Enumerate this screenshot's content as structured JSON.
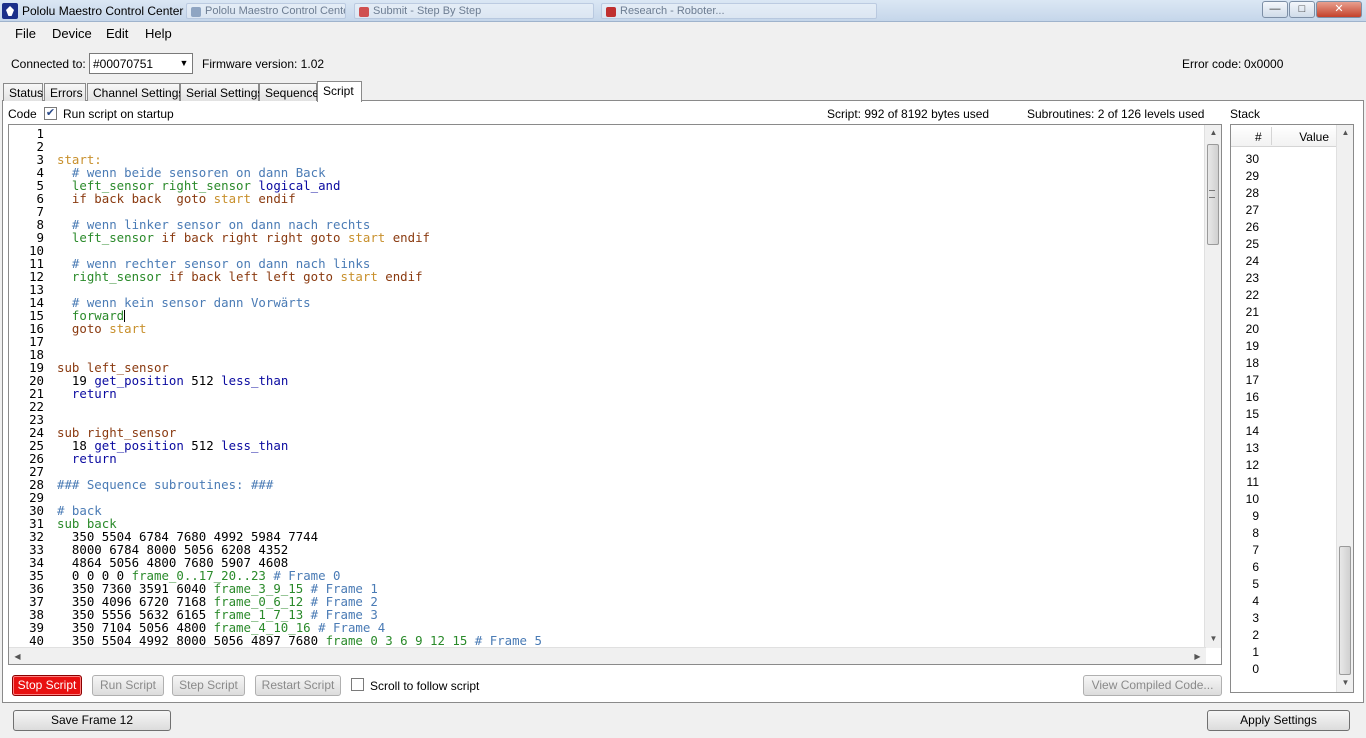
{
  "window": {
    "title": "Pololu Maestro Control Center",
    "background_tabs": [
      "Pololu Maestro Control Center (Windows) - ...",
      "Submit - Step By Step",
      "Research - Roboter..."
    ],
    "controls": {
      "minimize": "—",
      "maximize": "□",
      "close": "✕"
    }
  },
  "menu": [
    "File",
    "Device",
    "Edit",
    "Help"
  ],
  "connection": {
    "label": "Connected to:",
    "device": "#00070751",
    "firmware": "Firmware version: 1.02",
    "error_label": "Error code:",
    "error_value": "0x0000"
  },
  "tabs": [
    "Status",
    "Errors",
    "Channel Settings",
    "Serial Settings",
    "Sequence",
    "Script"
  ],
  "active_tab": "Script",
  "script": {
    "code_label": "Code",
    "run_on_startup_label": "Run script on startup",
    "run_on_startup": true,
    "bytes_used": "Script: 992 of 8192 bytes used",
    "subroutines": "Subroutines: 2 of 126 levels used",
    "cursor_line": 15
  },
  "code_lines": [
    {
      "n": "1",
      "parts": []
    },
    {
      "n": "2",
      "parts": []
    },
    {
      "n": "3",
      "parts": [
        {
          "t": "start:",
          "c": "#c8902c"
        }
      ]
    },
    {
      "n": "4",
      "parts": [
        {
          "t": "  # wenn beide sensoren on dann Back",
          "c": "#4a7bb5"
        }
      ]
    },
    {
      "n": "5",
      "parts": [
        {
          "t": "  left_sensor right_sensor ",
          "c": "#2a8a2a"
        },
        {
          "t": "logical_and",
          "c": "#0a0aa0"
        }
      ]
    },
    {
      "n": "6",
      "parts": [
        {
          "t": "  if back back  goto ",
          "c": "#8a3a10"
        },
        {
          "t": "start",
          "c": "#c8902c"
        },
        {
          "t": " endif",
          "c": "#8a3a10"
        }
      ]
    },
    {
      "n": "7",
      "parts": []
    },
    {
      "n": "8",
      "parts": [
        {
          "t": "  # wenn linker sensor on dann nach rechts",
          "c": "#4a7bb5"
        }
      ]
    },
    {
      "n": "9",
      "parts": [
        {
          "t": "  left_sensor ",
          "c": "#2a8a2a"
        },
        {
          "t": "if back right right goto ",
          "c": "#8a3a10"
        },
        {
          "t": "start",
          "c": "#c8902c"
        },
        {
          "t": " endif",
          "c": "#8a3a10"
        }
      ]
    },
    {
      "n": "10",
      "parts": []
    },
    {
      "n": "11",
      "parts": [
        {
          "t": "  # wenn rechter sensor on dann nach links",
          "c": "#4a7bb5"
        }
      ]
    },
    {
      "n": "12",
      "parts": [
        {
          "t": "  right_sensor ",
          "c": "#2a8a2a"
        },
        {
          "t": "if back left left goto ",
          "c": "#8a3a10"
        },
        {
          "t": "start",
          "c": "#c8902c"
        },
        {
          "t": " endif",
          "c": "#8a3a10"
        }
      ]
    },
    {
      "n": "13",
      "parts": []
    },
    {
      "n": "14",
      "parts": [
        {
          "t": "  # wenn kein sensor dann Vorwärts",
          "c": "#4a7bb5"
        }
      ]
    },
    {
      "n": "15",
      "parts": [
        {
          "t": "  forward",
          "c": "#2a8a2a"
        }
      ],
      "cursor": true
    },
    {
      "n": "16",
      "parts": [
        {
          "t": "  goto ",
          "c": "#8a3a10"
        },
        {
          "t": "start",
          "c": "#c8902c"
        }
      ]
    },
    {
      "n": "17",
      "parts": []
    },
    {
      "n": "18",
      "parts": []
    },
    {
      "n": "19",
      "parts": [
        {
          "t": "sub left_sensor",
          "c": "#8a3a10"
        }
      ]
    },
    {
      "n": "20",
      "parts": [
        {
          "t": "  19 ",
          "c": "#000000"
        },
        {
          "t": "get_position",
          "c": "#0a0aa0"
        },
        {
          "t": " 512 ",
          "c": "#000000"
        },
        {
          "t": "less_than",
          "c": "#0a0aa0"
        }
      ]
    },
    {
      "n": "21",
      "parts": [
        {
          "t": "  return",
          "c": "#0a0aa0"
        }
      ]
    },
    {
      "n": "22",
      "parts": []
    },
    {
      "n": "23",
      "parts": []
    },
    {
      "n": "24",
      "parts": [
        {
          "t": "sub right_sensor",
          "c": "#8a3a10"
        }
      ]
    },
    {
      "n": "25",
      "parts": [
        {
          "t": "  18 ",
          "c": "#000000"
        },
        {
          "t": "get_position",
          "c": "#0a0aa0"
        },
        {
          "t": " 512 ",
          "c": "#000000"
        },
        {
          "t": "less_than",
          "c": "#0a0aa0"
        }
      ]
    },
    {
      "n": "26",
      "parts": [
        {
          "t": "  return",
          "c": "#0a0aa0"
        }
      ]
    },
    {
      "n": "27",
      "parts": []
    },
    {
      "n": "28",
      "parts": [
        {
          "t": "### Sequence subroutines: ###",
          "c": "#4a7bb5"
        }
      ]
    },
    {
      "n": "29",
      "parts": []
    },
    {
      "n": "30",
      "parts": [
        {
          "t": "# back",
          "c": "#4a7bb5"
        }
      ]
    },
    {
      "n": "31",
      "parts": [
        {
          "t": "sub back",
          "c": "#2a8a2a"
        }
      ]
    },
    {
      "n": "32",
      "parts": [
        {
          "t": "  350 5504 6784 7680 4992 5984 7744",
          "c": "#000000"
        }
      ]
    },
    {
      "n": "33",
      "parts": [
        {
          "t": "  8000 6784 8000 5056 6208 4352",
          "c": "#000000"
        }
      ]
    },
    {
      "n": "34",
      "parts": [
        {
          "t": "  4864 5056 4800 7680 5907 4608",
          "c": "#000000"
        }
      ]
    },
    {
      "n": "35",
      "parts": [
        {
          "t": "  0 0 0 0 ",
          "c": "#000000"
        },
        {
          "t": "frame_0..17_20..23",
          "c": "#2a8a2a"
        },
        {
          "t": " # Frame 0",
          "c": "#4a7bb5"
        }
      ]
    },
    {
      "n": "36",
      "parts": [
        {
          "t": "  350 7360 3591 6040 ",
          "c": "#000000"
        },
        {
          "t": "frame_3_9_15",
          "c": "#2a8a2a"
        },
        {
          "t": " # Frame 1",
          "c": "#4a7bb5"
        }
      ]
    },
    {
      "n": "37",
      "parts": [
        {
          "t": "  350 4096 6720 7168 ",
          "c": "#000000"
        },
        {
          "t": "frame_0_6_12",
          "c": "#2a8a2a"
        },
        {
          "t": " # Frame 2",
          "c": "#4a7bb5"
        }
      ]
    },
    {
      "n": "38",
      "parts": [
        {
          "t": "  350 5556 5632 6165 ",
          "c": "#000000"
        },
        {
          "t": "frame_1_7_13",
          "c": "#2a8a2a"
        },
        {
          "t": " # Frame 3",
          "c": "#4a7bb5"
        }
      ]
    },
    {
      "n": "39",
      "parts": [
        {
          "t": "  350 7104 5056 4800 ",
          "c": "#000000"
        },
        {
          "t": "frame_4_10_16",
          "c": "#2a8a2a"
        },
        {
          "t": " # Frame 4",
          "c": "#4a7bb5"
        }
      ]
    },
    {
      "n": "40",
      "parts": [
        {
          "t": "  350 5504 4992 8000 5056 4897 7680 ",
          "c": "#000000"
        },
        {
          "t": "frame_0_3_6_9_12_15",
          "c": "#2a8a2a"
        },
        {
          "t": " # Frame 5",
          "c": "#4a7bb5"
        }
      ]
    }
  ],
  "buttons": {
    "stop": "Stop Script",
    "run": "Run Script",
    "step": "Step Script",
    "restart": "Restart Script",
    "scroll_follow": "Scroll to follow script",
    "view_compiled": "View Compiled Code...",
    "save_frame": "Save Frame 12",
    "apply": "Apply Settings"
  },
  "stack": {
    "title": "Stack",
    "col_num": "#",
    "col_value": "Value",
    "rows": [
      "30",
      "29",
      "28",
      "27",
      "26",
      "25",
      "24",
      "23",
      "22",
      "21",
      "20",
      "19",
      "18",
      "17",
      "16",
      "15",
      "14",
      "13",
      "12",
      "11",
      "10",
      "9",
      "8",
      "7",
      "6",
      "5",
      "4",
      "3",
      "2",
      "1",
      "0"
    ]
  },
  "colors": {
    "stop_button": "#e81010",
    "titlebar": "#c5d6ea"
  }
}
